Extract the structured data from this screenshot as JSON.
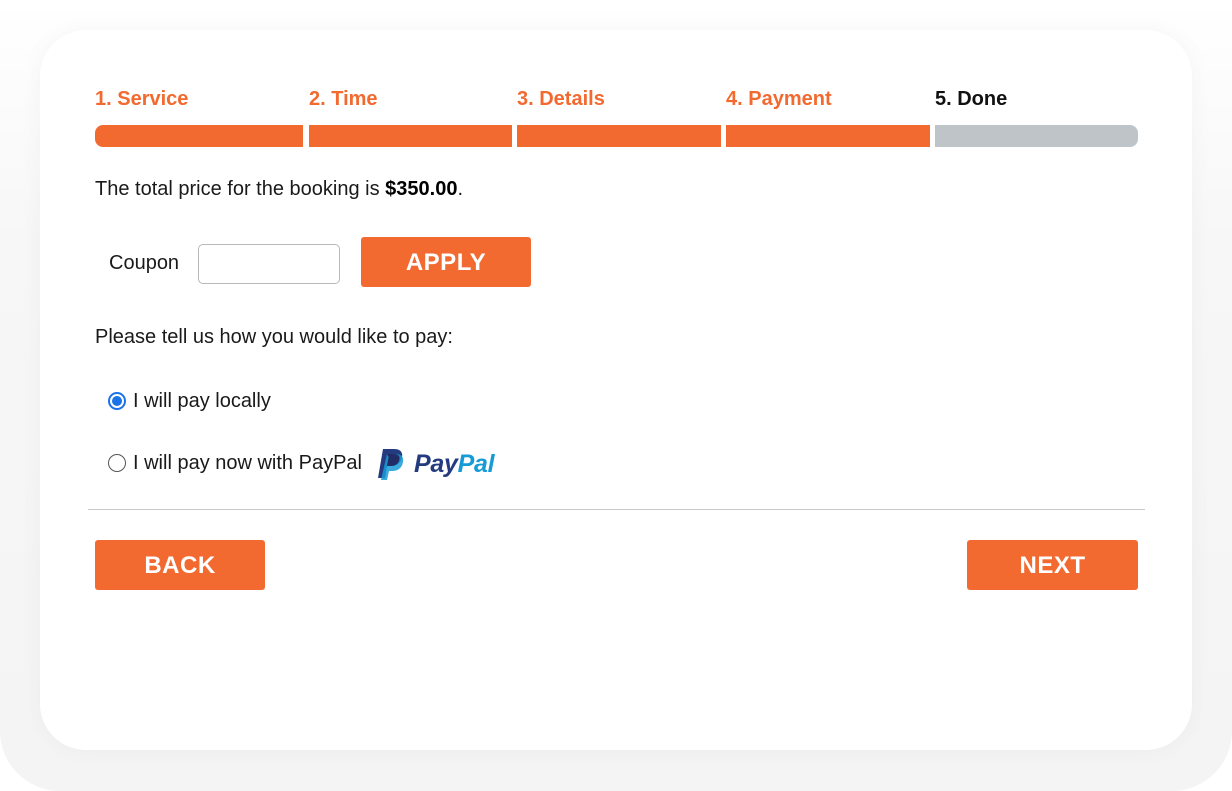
{
  "steps": [
    {
      "label": "1. Service",
      "state": "complete"
    },
    {
      "label": "2. Time",
      "state": "complete"
    },
    {
      "label": "3. Details",
      "state": "complete"
    },
    {
      "label": "4. Payment",
      "state": "current"
    },
    {
      "label": "5. Done",
      "state": "pending"
    }
  ],
  "price": {
    "prefix": "The total price for the booking is ",
    "amount": "$350.00",
    "suffix": "."
  },
  "coupon": {
    "label": "Coupon",
    "value": "",
    "placeholder": "",
    "apply_label": "APPLY"
  },
  "payment": {
    "prompt": "Please tell us how you would like to pay:",
    "options": [
      {
        "label": "I will pay locally",
        "selected": true
      },
      {
        "label": "I will pay now with PayPal",
        "selected": false
      }
    ],
    "logo": {
      "pay": "Pay",
      "pal": "Pal"
    }
  },
  "nav": {
    "back_label": "BACK",
    "next_label": "NEXT"
  },
  "colors": {
    "accent": "#f26a30",
    "inactive_bar": "#bfc4c8",
    "radio_selected": "#1a73e8",
    "paypal_dark": "#253b80",
    "paypal_light": "#179bd7"
  }
}
